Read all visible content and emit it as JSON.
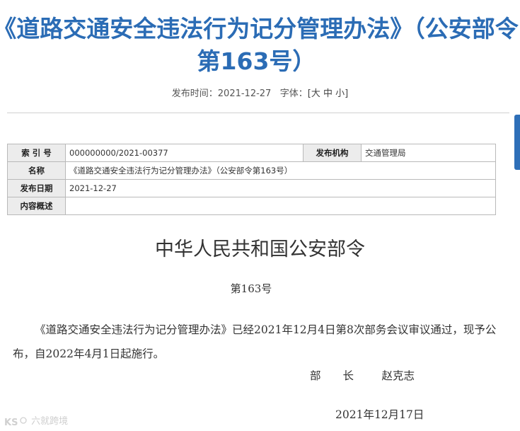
{
  "article": {
    "title_line1": "《道路交通安全违法行为记分管理办法》（公安部令",
    "title_line2": "第163号）",
    "publish_time_label": "发布时间：",
    "publish_time": "2021-12-27",
    "font_size_label": "字体：",
    "font_size_options": [
      "[大",
      "中",
      "小]"
    ]
  },
  "info_table": {
    "index_label": "索 引 号",
    "index_value": "000000000/2021-00377",
    "agency_label": "发布机构",
    "agency_value": "交通管理局",
    "name_label": "名称",
    "name_value": "《道路交通安全违法行为记分管理办法》（公安部令第163号）",
    "date_label": "发布日期",
    "date_value": "2021-12-27",
    "summary_label": "内容概述",
    "summary_value": ""
  },
  "document": {
    "heading": "中华人民共和国公安部令",
    "number": "第163号",
    "body": "《道路交通安全违法行为记分管理办法》已经2021年12月4日第8次部务会议审议通过，现予公布，自2022年4月1日起施行。",
    "signature_title": "部　　长",
    "signature_name": "赵克志",
    "date": "2021年12月17日"
  },
  "watermark": {
    "text": "六就跨境"
  }
}
